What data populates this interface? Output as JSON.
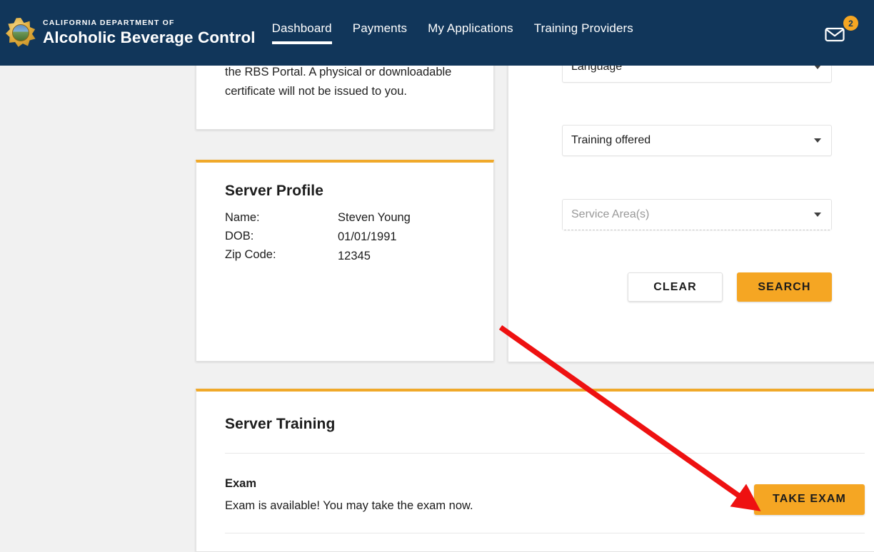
{
  "header": {
    "brand_sub": "CALIFORNIA DEPARTMENT OF",
    "brand_main": "Alcoholic Beverage Control",
    "logo_icon": "abc-star-seal-icon",
    "nav": [
      {
        "label": "Dashboard",
        "active": true
      },
      {
        "label": "Payments",
        "active": false
      },
      {
        "label": "My Applications",
        "active": false
      },
      {
        "label": "Training Providers",
        "active": false
      }
    ],
    "messages": {
      "icon": "envelope-icon",
      "badge_count": "2"
    },
    "colors": {
      "header_bg": "#11365a",
      "badge_bg": "#f5a623"
    }
  },
  "certificate_card": {
    "body": "the RBS Portal. A physical or downloadable certificate will not be issued to you."
  },
  "server_profile": {
    "title": "Server Profile",
    "rows": [
      {
        "label": "Name:",
        "value": "Steven Young"
      },
      {
        "label": "DOB:",
        "value": "01/01/1991"
      },
      {
        "label": "Zip Code:",
        "value": "12345"
      }
    ]
  },
  "search_panel": {
    "fields": [
      {
        "name": "language",
        "value": "Language",
        "is_placeholder": false,
        "icon": "chevron-down-icon"
      },
      {
        "name": "training-offered",
        "value": "Training offered",
        "is_placeholder": false,
        "icon": "chevron-down-icon"
      },
      {
        "name": "service-areas",
        "value": "Service Area(s)",
        "is_placeholder": true,
        "icon": "chevron-down-icon"
      }
    ],
    "clear_label": "CLEAR",
    "search_label": "SEARCH",
    "accent_color": "#f5a623"
  },
  "server_training": {
    "title": "Server Training",
    "exam": {
      "heading": "Exam",
      "description": "Exam is available! You may take the exam now.",
      "button_label": "TAKE EXAM"
    }
  },
  "annotation": {
    "type": "arrow",
    "color": "#ee1111",
    "points_to": "take-exam-button"
  }
}
